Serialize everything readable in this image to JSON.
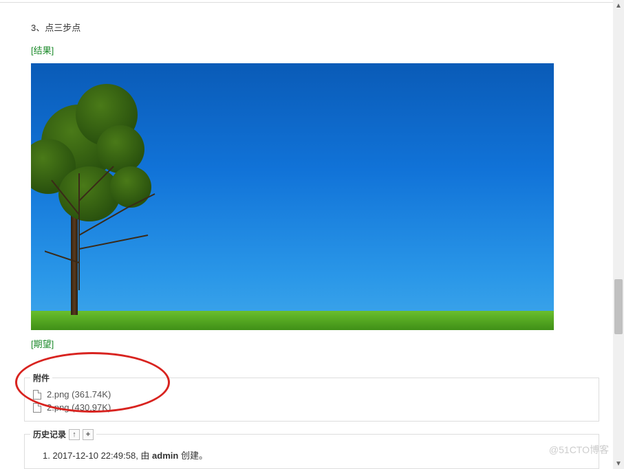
{
  "step_text": "3、点三步点",
  "result_label": "[结果]",
  "expect_label": "[期望]",
  "attachments": {
    "legend": "附件",
    "files": [
      {
        "name": "2.png",
        "size": "361.74K"
      },
      {
        "name": "2.png",
        "size": "430.97K"
      }
    ]
  },
  "history": {
    "legend": "历史记录",
    "items": [
      {
        "index": "1.",
        "timestamp": "2017-12-10 22:49:58",
        "by_prefix": ", 由 ",
        "user": "admin",
        "action": " 创建。"
      }
    ]
  },
  "watermark": "@51CTO博客"
}
